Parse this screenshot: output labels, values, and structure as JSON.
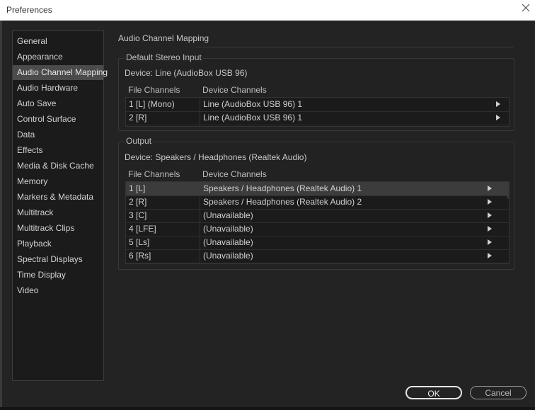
{
  "window": {
    "title": "Preferences"
  },
  "nav": {
    "items": [
      {
        "label": "General"
      },
      {
        "label": "Appearance"
      },
      {
        "label": "Audio Channel Mapping",
        "selected": true
      },
      {
        "label": "Audio Hardware"
      },
      {
        "label": "Auto Save"
      },
      {
        "label": "Control Surface"
      },
      {
        "label": "Data"
      },
      {
        "label": "Effects"
      },
      {
        "label": "Media & Disk Cache"
      },
      {
        "label": "Memory"
      },
      {
        "label": "Markers & Metadata"
      },
      {
        "label": "Multitrack"
      },
      {
        "label": "Multitrack Clips"
      },
      {
        "label": "Playback"
      },
      {
        "label": "Spectral Displays"
      },
      {
        "label": "Time Display"
      },
      {
        "label": "Video"
      }
    ]
  },
  "main": {
    "title": "Audio Channel Mapping",
    "input": {
      "legend": "Default Stereo Input",
      "device": "Device: Line (AudioBox USB 96)",
      "col_file": "File Channels",
      "col_device": "Device Channels",
      "rows": [
        {
          "file": "1 [L] (Mono)",
          "device": "Line (AudioBox USB 96) 1"
        },
        {
          "file": "2 [R]",
          "device": "Line (AudioBox USB 96) 1"
        }
      ]
    },
    "output": {
      "legend": "Output",
      "device": "Device: Speakers / Headphones (Realtek Audio)",
      "col_file": "File Channels",
      "col_device": "Device Channels",
      "rows": [
        {
          "file": "1 [L]",
          "device": "Speakers / Headphones (Realtek Audio) 1",
          "selected": true
        },
        {
          "file": "2 [R]",
          "device": "Speakers / Headphones (Realtek Audio) 2"
        },
        {
          "file": "3 [C]",
          "device": "(Unavailable)"
        },
        {
          "file": "4 [LFE]",
          "device": "(Unavailable)"
        },
        {
          "file": "5 [Ls]",
          "device": "(Unavailable)"
        },
        {
          "file": "6 [Rs]",
          "device": "(Unavailable)"
        }
      ]
    }
  },
  "buttons": {
    "ok": "OK",
    "cancel": "Cancel"
  },
  "icons": {
    "close": "close-icon",
    "arrow": "triangle-right-icon"
  }
}
